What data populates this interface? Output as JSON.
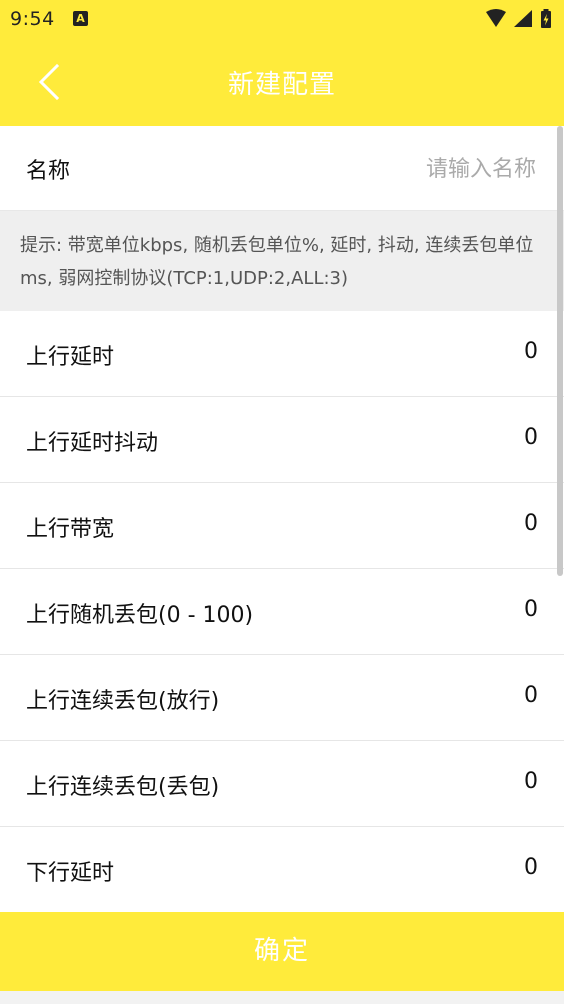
{
  "status_bar": {
    "time": "9:54",
    "notification_icon": "A"
  },
  "app_bar": {
    "title": "新建配置",
    "back_icon": "chevron-left"
  },
  "name_field": {
    "label": "名称",
    "placeholder": "请输入名称",
    "value": ""
  },
  "hint": {
    "text": "提示: 带宽单位kbps, 随机丢包单位%, 延时, 抖动, 连续丢包单位ms, 弱网控制协议(TCP:1,UDP:2,ALL:3)"
  },
  "params": [
    {
      "label": "上行延时",
      "value": "0"
    },
    {
      "label": "上行延时抖动",
      "value": "0"
    },
    {
      "label": "上行带宽",
      "value": "0"
    },
    {
      "label": "上行随机丢包(0 - 100)",
      "value": "0"
    },
    {
      "label": "上行连续丢包(放行)",
      "value": "0"
    },
    {
      "label": "上行连续丢包(丢包)",
      "value": "0"
    },
    {
      "label": "下行延时",
      "value": "0"
    }
  ],
  "confirm_button": {
    "label": "确定"
  },
  "colors": {
    "accent": "#FFEB3B",
    "hint_bg": "#EFEFEF",
    "text": "#111111",
    "placeholder": "#AAAAAA"
  }
}
